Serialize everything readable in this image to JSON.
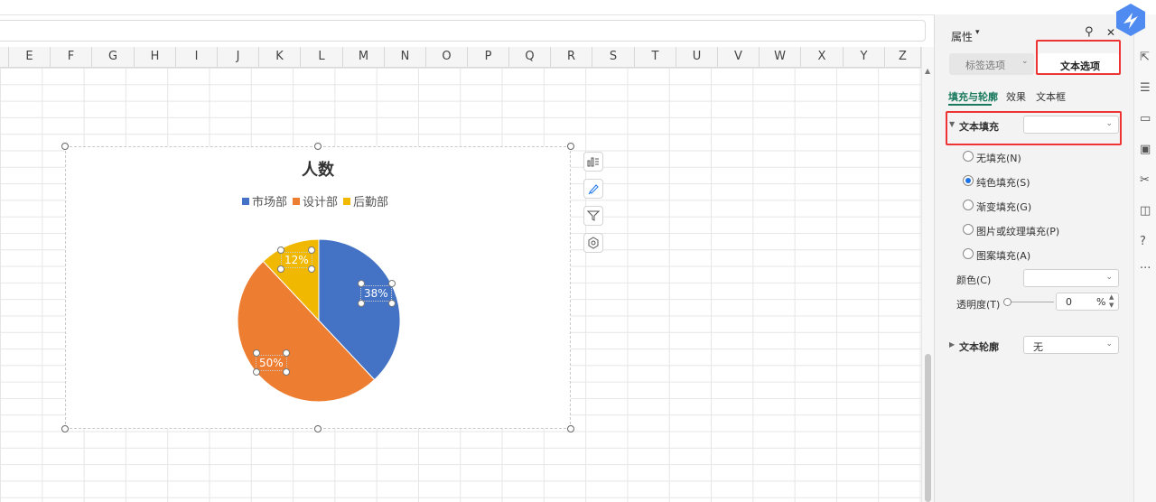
{
  "column_headers": [
    "E",
    "F",
    "G",
    "H",
    "I",
    "J",
    "K",
    "L",
    "M",
    "N",
    "O",
    "P",
    "Q",
    "R",
    "S",
    "T",
    "U",
    "V",
    "W",
    "X",
    "Y",
    "Z"
  ],
  "chart": {
    "title": "人数",
    "tools": [
      "chart-elements-icon",
      "chart-style-icon",
      "chart-filter-icon",
      "chart-settings-icon"
    ]
  },
  "chart_data": {
    "type": "pie",
    "title": "人数",
    "categories": [
      "市场部",
      "设计部",
      "后勤部"
    ],
    "values": [
      38,
      50,
      12
    ],
    "labels": [
      "38%",
      "50%",
      "12%"
    ],
    "colors": [
      "#4472c4",
      "#ed7d31",
      "#f0b800"
    ],
    "legend": "top"
  },
  "panel": {
    "header": "属性",
    "tabs": {
      "label_options": "标签选项",
      "text_options": "文本选项"
    },
    "subtabs": [
      "填充与轮廓",
      "效果",
      "文本框"
    ],
    "text_fill": {
      "title": "文本填充",
      "options": [
        "无填充(N)",
        "纯色填充(S)",
        "渐变填充(G)",
        "图片或纹理填充(P)",
        "图案填充(A)"
      ],
      "selected": 1,
      "color_label": "颜色(C)",
      "transparency_label": "透明度(T)",
      "transparency_value": "0",
      "transparency_unit": "%"
    },
    "text_outline": {
      "title": "文本轮廓",
      "value": "无"
    }
  }
}
